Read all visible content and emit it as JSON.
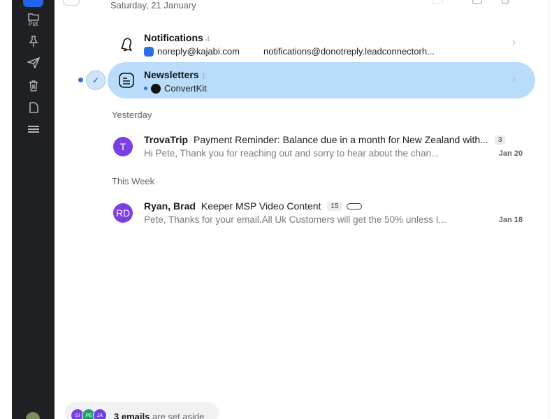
{
  "sidebar": {
    "items": [
      {
        "icon": "inbox-icon",
        "label": ""
      },
      {
        "icon": "folder-icon",
        "label": "Pet"
      },
      {
        "icon": "pin-icon",
        "label": ""
      },
      {
        "icon": "send-icon",
        "label": ""
      },
      {
        "icon": "trash-icon",
        "label": ""
      },
      {
        "icon": "document-icon",
        "label": ""
      },
      {
        "icon": "menu-icon",
        "label": ""
      }
    ]
  },
  "sections": {
    "saturday": "Saturday, 21 January",
    "yesterday": "Yesterday",
    "this_week": "This Week"
  },
  "bundles": [
    {
      "title": "Notifications",
      "count": "4",
      "senders": [
        "noreply@kajabi.com",
        "notifications@donotreply.leadconnectorh..."
      ],
      "icon": "bell-icon"
    },
    {
      "title": "Newsletters",
      "count": "1",
      "senders": [
        "ConvertKit"
      ],
      "icon": "newspaper-icon"
    }
  ],
  "emails": [
    {
      "avatar": "T",
      "avatar_color": "#7b3fe4",
      "sender": "TrovaTrip",
      "subject": "Payment Reminder: Balance due in a month for New Zealand with...",
      "count": "3",
      "snippet": "Hi Pete, Thank you for reaching out and sorry to hear about the chan...",
      "date": "Jan 20"
    },
    {
      "avatar": "RD",
      "avatar_color": "#7b3fe4",
      "sender": "Ryan, Brad",
      "subject": "Keeper MSP Video Content",
      "count": "15",
      "snippet": "Pete, Thanks for your email.All Uk Customers will get the 50% unless I...",
      "date": "Jan 18"
    }
  ],
  "set_aside": {
    "avatars": [
      "SI",
      "PE",
      "JA"
    ],
    "avatar_colors": [
      "#7b3fe4",
      "#22a06b",
      "#6e40e8"
    ],
    "count_label": "3 emails",
    "suffix": "are set aside"
  },
  "colors": {
    "sidebar_bg": "#1f2023",
    "accent": "#2563eb",
    "selected_row": "#b9dcfb"
  }
}
